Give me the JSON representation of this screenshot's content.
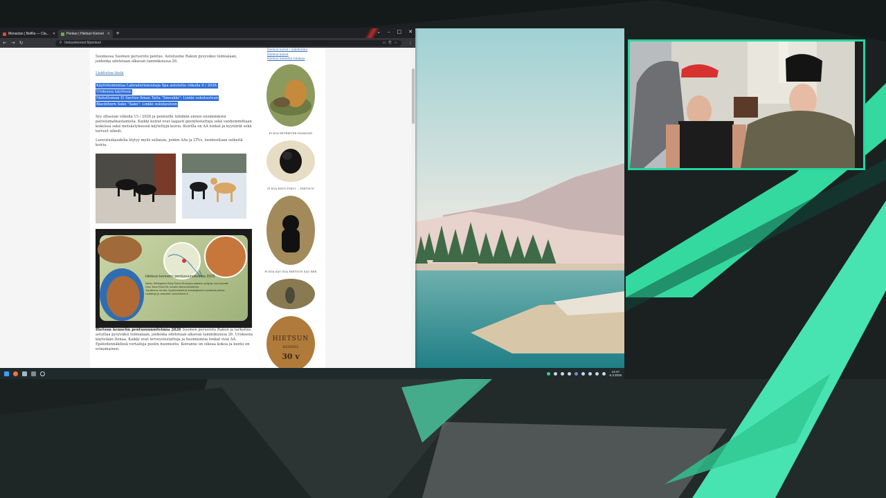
{
  "browser": {
    "tabs": [
      {
        "label": "Monaclan | BelRa — Cla...",
        "active": false
      },
      {
        "label": "Pentue | Hietsun Kennel",
        "active": true
      }
    ],
    "url": "hietsunkennel.fi/pentue/"
  },
  "page": {
    "intro": "Suomessa Suomen perusrotu pentue. Astutusme Rakun pysyväksi toimialaan, joidenka odotetaan alkavan tammikuussa 26.",
    "more_link": "Lisätietoa tästä",
    "highlight": [
      "Käyttötoimintaa Labradorinnoutaja Spa astutettu viikolla 9 / 2026.",
      "Uroksena käytössä:",
      "Mahottoman El Savitos Ilman Talta \"Smoukki\": Linkki sukutauluun",
      "Blackthorn Sako \"Sako\": Linkki sukutauluun"
    ],
    "para1": "Syy oltasean viikolla 15 / 2026 ja pennuille tehdään ennen ensimmäistä palvelumatkastamista. Kaikki koirat ovat laajasti geenitestattuja sekä vanhemmittaan kokeissa sekä metsästyksessä käytettyjä koiria. Koirilla on AA lonkat ja kyynärät sekä terveet silmät.",
    "para2": "Luovutuskaudella löytyy myös sellaisia, joiden AAs ja LTVs, luonteeltaan selkeitä koiria.",
    "poster": {
      "title": "Hietsun kennelin pentusuunnitelmia 2026",
      "lines": [
        "Narttu: Siblingstolin Ruby Robot ISt-kisojen pakkaus syntynyt, oma kasvatti",
        "Uros: Ilona Robot ISt, kuvattu ulkona tavoitteena",
        "Tavoitteena: terveet, hyväluonteiset ja metsästykseen soveltuvat pennut.",
        "Lisätietoja ja varaukset: www.hietsun.fi"
      ]
    },
    "bottom": {
      "bold": "Hietsun kennelin pentusuunnitelmia 2026",
      "text": "Suomen perusrotu Rakun ja tarkoitus astuttaa pysyväksi toimialaan, joidenka odotetaan alkavan tammikuussa 26. Uroksena käytetään Ilonaa. Kaikki ovat terveystestattuja ja huomiointia lonkat ovat AA. Epätodennäköisiä vertailuja puolin huomioitu. Koiranne on oikeaa kokoa ja kunto on erinomainen."
    },
    "sidebar": {
      "links": [
        "Hietsun koirat / näkökulma",
        "Hietsun koirat",
        "Hietsun kennelin tuloksia"
      ],
      "captions": [
        "FI KVA RETRIEVER DIAMOND",
        "FI KVA RDTS PYKUI ... HIETSUN",
        "FI KVA SAU KVA HIETSUN SAU BEE"
      ],
      "sign": [
        "HIETSUN",
        "KENNEL",
        "30 v"
      ]
    }
  },
  "taskbar": {
    "time": "13:47",
    "date": "6.3.2026"
  },
  "colors": {
    "accent_teal": "#23d6a0",
    "highlight_blue": "#2f6ed8",
    "link_blue": "#3a6fb0"
  }
}
